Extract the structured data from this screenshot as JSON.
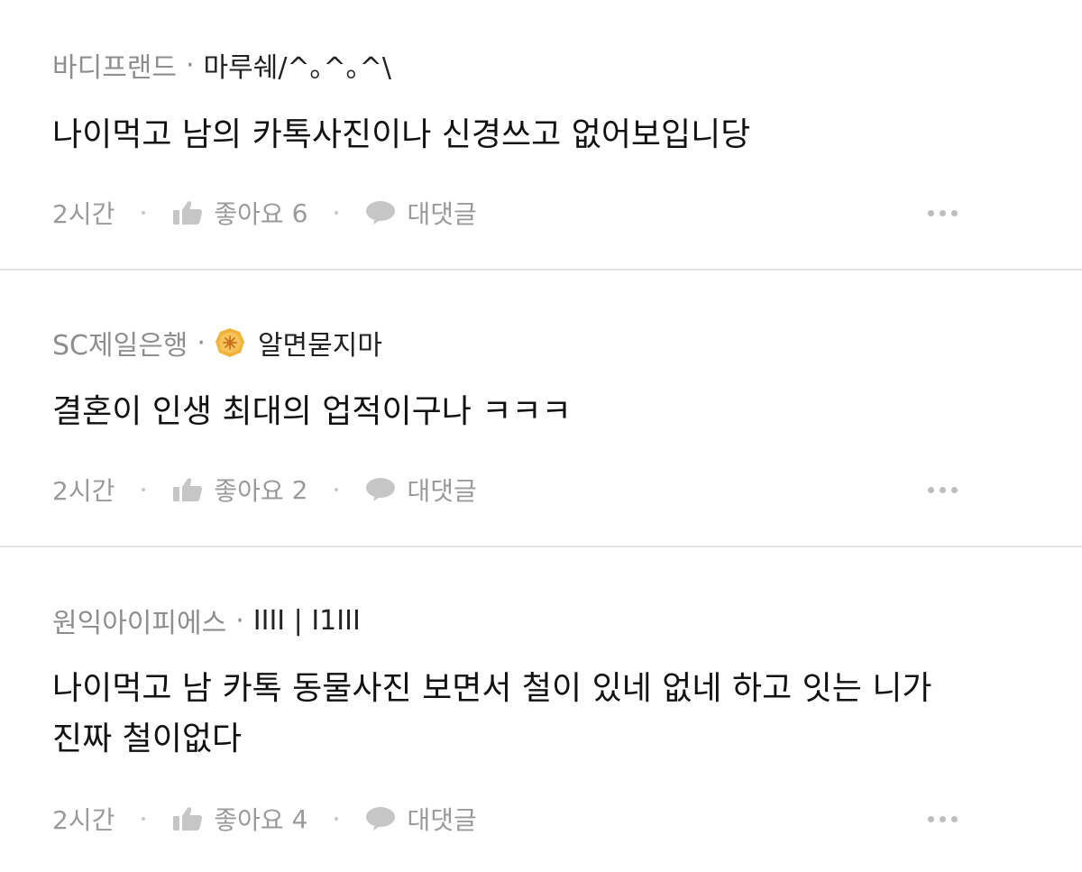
{
  "comments": [
    {
      "company": "바디프랜드",
      "separator": "·",
      "nickname": "마루쉐/^｡^｡^\\",
      "has_badge": false,
      "text": "나이먹고 남의 카톡사진이나 신경쓰고 없어보입니당",
      "time": "2시간",
      "like_label": "좋아요",
      "like_count": "6",
      "reply_label": "대댓글"
    },
    {
      "company": "SC제일은행",
      "separator": "·",
      "nickname": "알면묻지마",
      "has_badge": true,
      "badge_color": "#f2b23a",
      "text": "결혼이 인생 최대의 업적이구나 ㅋㅋㅋ",
      "time": "2시간",
      "like_label": "좋아요",
      "like_count": "2",
      "reply_label": "대댓글"
    },
    {
      "company": "원익아이피에스",
      "separator": "·",
      "nickname": "IIII | I1III",
      "has_badge": false,
      "text": "나이먹고 남 카톡 동물사진 보면서 철이 있네 없네 하고 잇는 니가\n진짜 철이없다",
      "time": "2시간",
      "like_label": "좋아요",
      "like_count": "4",
      "reply_label": "대댓글"
    }
  ],
  "icons": {
    "like": "thumbs-up-icon",
    "reply": "speech-bubble-icon",
    "more": "more-dots-icon",
    "badge": "gold-badge-icon"
  },
  "colors": {
    "muted_text": "#9a9a9a",
    "divider": "#e4e4e4",
    "badge": "#f2b23a"
  }
}
